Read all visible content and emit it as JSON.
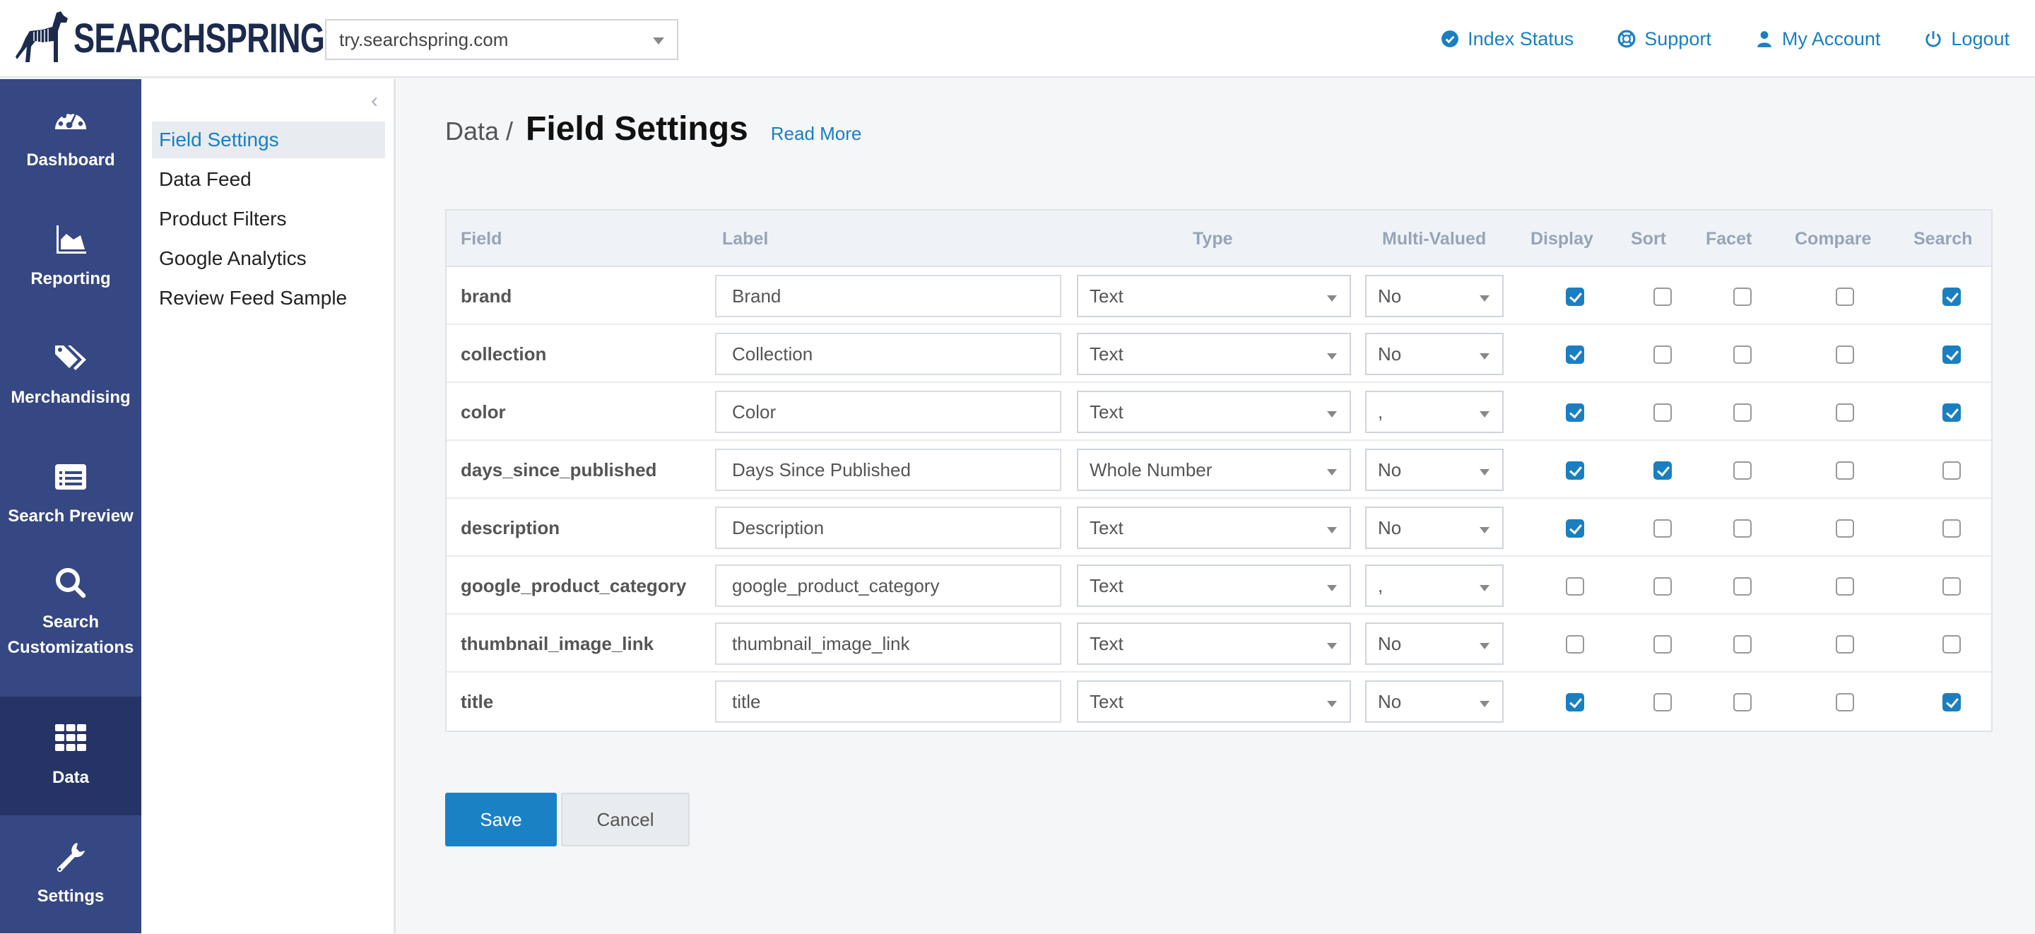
{
  "header": {
    "logo_text": "SEARCHSPRING",
    "site_select": {
      "value": "try.searchspring.com"
    },
    "links": [
      {
        "label": "Index Status",
        "icon": "check-circle-icon"
      },
      {
        "label": "Support",
        "icon": "life-ring-icon"
      },
      {
        "label": "My Account",
        "icon": "user-icon"
      },
      {
        "label": "Logout",
        "icon": "power-icon"
      }
    ]
  },
  "leftnav": {
    "items": [
      {
        "label": "Dashboard",
        "icon": "dashboard-gauge-icon",
        "active": false
      },
      {
        "label": "Reporting",
        "icon": "area-chart-icon",
        "active": false
      },
      {
        "label": "Merchandising",
        "icon": "tags-icon",
        "active": false
      },
      {
        "label": "Search Preview",
        "icon": "list-alt-icon",
        "active": false
      },
      {
        "label": "Search Customizations",
        "icon": "search-icon",
        "active": false
      },
      {
        "label": "Data",
        "icon": "grid-icon",
        "active": true
      },
      {
        "label": "Settings",
        "icon": "wrench-icon",
        "active": false
      }
    ]
  },
  "subnav": {
    "items": [
      {
        "label": "Field Settings",
        "active": true
      },
      {
        "label": "Data Feed",
        "active": false
      },
      {
        "label": "Product Filters",
        "active": false
      },
      {
        "label": "Google Analytics",
        "active": false
      },
      {
        "label": "Review Feed Sample",
        "active": false
      }
    ]
  },
  "page": {
    "breadcrumb": "Data /",
    "title": "Field Settings",
    "read_more": "Read More"
  },
  "table": {
    "columns": [
      "Field",
      "Label",
      "Type",
      "Multi-Valued",
      "Display",
      "Sort",
      "Facet",
      "Compare",
      "Search"
    ],
    "rows": [
      {
        "field": "brand",
        "label": "Brand",
        "type": "Text",
        "multi": "No",
        "display": true,
        "sort": false,
        "facet": false,
        "compare": false,
        "search": true
      },
      {
        "field": "collection",
        "label": "Collection",
        "type": "Text",
        "multi": "No",
        "display": true,
        "sort": false,
        "facet": false,
        "compare": false,
        "search": true
      },
      {
        "field": "color",
        "label": "Color",
        "type": "Text",
        "multi": ",",
        "display": true,
        "sort": false,
        "facet": false,
        "compare": false,
        "search": true
      },
      {
        "field": "days_since_published",
        "label": "Days Since Published",
        "type": "Whole Number",
        "multi": "No",
        "display": true,
        "sort": true,
        "facet": false,
        "compare": false,
        "search": false
      },
      {
        "field": "description",
        "label": "Description",
        "type": "Text",
        "multi": "No",
        "display": true,
        "sort": false,
        "facet": false,
        "compare": false,
        "search": false
      },
      {
        "field": "google_product_category",
        "label": "google_product_category",
        "type": "Text",
        "multi": ",",
        "display": false,
        "sort": false,
        "facet": false,
        "compare": false,
        "search": false
      },
      {
        "field": "thumbnail_image_link",
        "label": "thumbnail_image_link",
        "type": "Text",
        "multi": "No",
        "display": false,
        "sort": false,
        "facet": false,
        "compare": false,
        "search": false
      },
      {
        "field": "title",
        "label": "title",
        "type": "Text",
        "multi": "No",
        "display": true,
        "sort": false,
        "facet": false,
        "compare": false,
        "search": true
      }
    ]
  },
  "actions": {
    "save": "Save",
    "cancel": "Cancel"
  },
  "colors": {
    "accent": "#1a7fc1",
    "nav_bg": "#364883",
    "nav_active_bg": "#253366"
  }
}
